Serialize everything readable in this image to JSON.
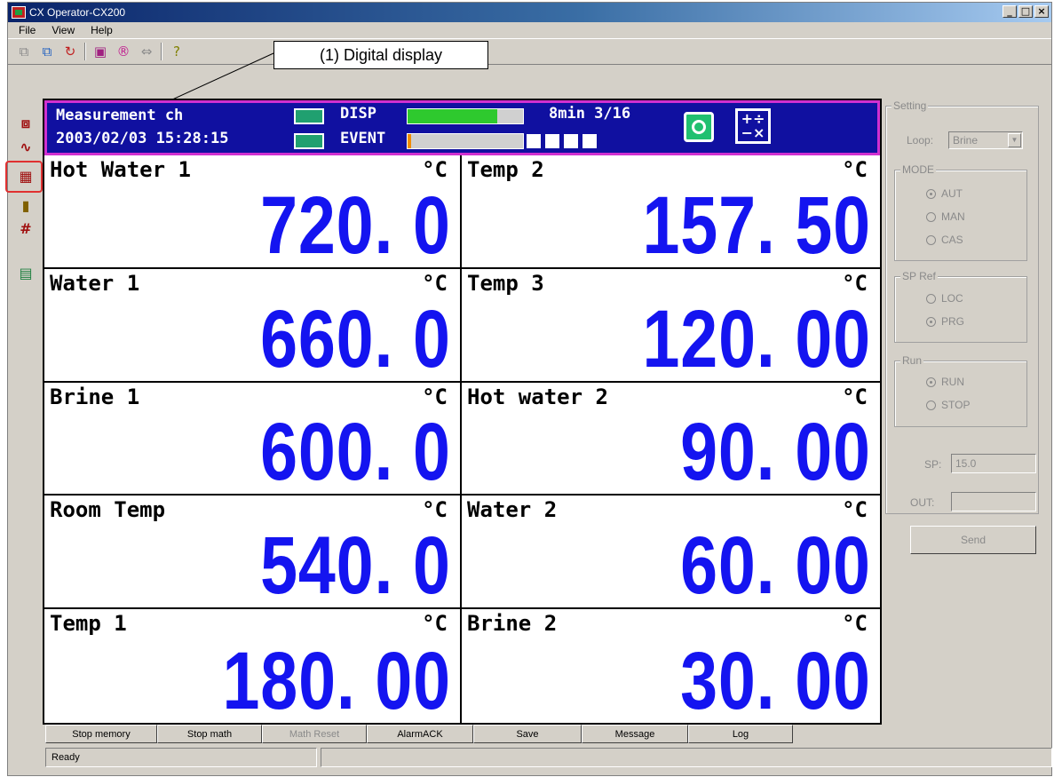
{
  "window": {
    "title": "CX Operator-CX200",
    "min_label": "_",
    "max_label": "□",
    "close_label": "×"
  },
  "menu": [
    "File",
    "View",
    "Help"
  ],
  "toolbar_icons": [
    "network-icon",
    "connect-icon",
    "refresh-icon",
    "record-icon",
    "registered-icon",
    "transfer-icon",
    "help-icon"
  ],
  "sidebar_icons": [
    "overview-icon",
    "trend-icon",
    "digital-display-icon",
    "bar-graph-icon",
    "hash-icon",
    "report-icon"
  ],
  "callout": {
    "text": "(1) Digital display"
  },
  "display_status": {
    "name": "Measurement ch",
    "datetime": "2003/02/03 15:28:15",
    "disp_label": "DISP",
    "event_label": "EVENT",
    "disp_fill_pct": 78,
    "event_fill_pct": 3,
    "time_text": "8min 3/16",
    "disp_bar_color": "#2ec92e",
    "event_bar_color": "#f08c00",
    "math_label": "+÷\n−×"
  },
  "channels": [
    {
      "name": "Hot Water 1",
      "unit": "°C",
      "value": "720. 0"
    },
    {
      "name": "Temp 2",
      "unit": "°C",
      "value": "157. 50"
    },
    {
      "name": "Water 1",
      "unit": "°C",
      "value": "660. 0"
    },
    {
      "name": "Temp 3",
      "unit": "°C",
      "value": "120. 00"
    },
    {
      "name": "Brine 1",
      "unit": "°C",
      "value": "600. 0"
    },
    {
      "name": "Hot water 2",
      "unit": "°C",
      "value": "90. 00"
    },
    {
      "name": "Room Temp",
      "unit": "°C",
      "value": "540. 0"
    },
    {
      "name": "Water 2",
      "unit": "°C",
      "value": "60. 00"
    },
    {
      "name": "Temp 1",
      "unit": "°C",
      "value": "180. 00"
    },
    {
      "name": "Brine 2",
      "unit": "°C",
      "value": "30. 00"
    }
  ],
  "value_color": "#1414f0",
  "panel": {
    "setting_title": "Setting",
    "loop_label": "Loop:",
    "loop_value": "Brine",
    "combo_arrow": "▼",
    "mode_title": "MODE",
    "mode_options": [
      "AUT",
      "MAN",
      "CAS"
    ],
    "mode_selected": "AUT",
    "spref_title": "SP Ref",
    "spref_options": [
      "LOC",
      "PRG"
    ],
    "spref_selected": "PRG",
    "run_title": "Run",
    "run_options": [
      "RUN",
      "STOP"
    ],
    "run_selected": "RUN",
    "sp_label": "SP:",
    "sp_value": "15.0",
    "out_label": "OUT:",
    "out_value": "",
    "send_label": "Send"
  },
  "bottom_buttons": [
    {
      "label": "Stop memory",
      "enabled": true
    },
    {
      "label": "Stop math",
      "enabled": true
    },
    {
      "label": "Math Reset",
      "enabled": false
    },
    {
      "label": "AlarmACK",
      "enabled": true
    },
    {
      "label": "Save",
      "enabled": true
    },
    {
      "label": "Message",
      "enabled": true
    },
    {
      "label": "Log",
      "enabled": true
    }
  ],
  "status_text": "Ready"
}
